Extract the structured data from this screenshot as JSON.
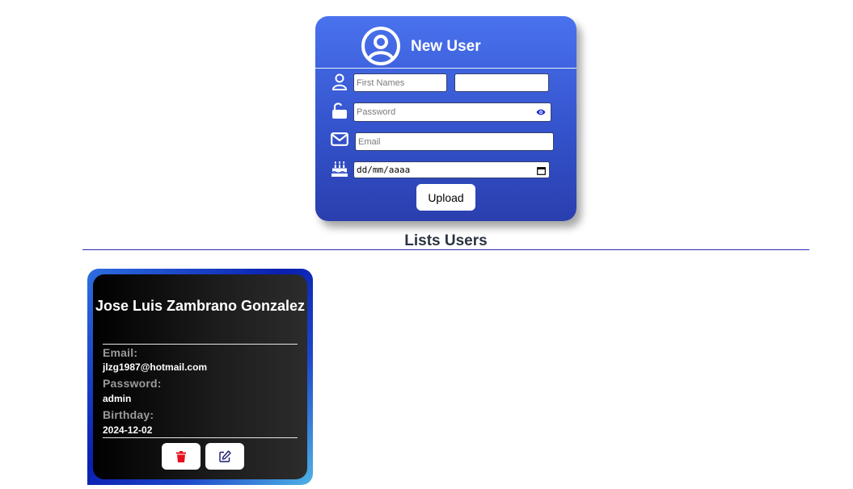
{
  "form": {
    "title": "New User",
    "first_names_placeholder": "First Names",
    "last_names_value": "",
    "password_placeholder": "Password",
    "email_placeholder": "Email",
    "birthday_value": "dd/mm/aaaa",
    "upload_label": "Upload"
  },
  "list": {
    "title": "Lists Users",
    "users": [
      {
        "name": "Jose Luis Zambrano Gonzalez",
        "email_label": "Email:",
        "email": "jlzg1987@hotmail.com",
        "password_label": "Password:",
        "password": "admin",
        "birthday_label": "Birthday:",
        "birthday": "2024-12-02"
      }
    ]
  },
  "colors": {
    "form_gradient_top": "#4a72ee",
    "form_gradient_bottom": "#2a3fae",
    "delete_icon": "#e8101e",
    "edit_icon": "#1a1a6e",
    "eye_icon": "#1f2fd0",
    "divider": "#2a2ab8"
  },
  "icons": [
    "user-circle-icon",
    "user-icon",
    "unlock-icon",
    "envelope-icon",
    "birthday-cake-icon",
    "eye-icon",
    "calendar-icon",
    "trash-icon",
    "edit-icon"
  ]
}
